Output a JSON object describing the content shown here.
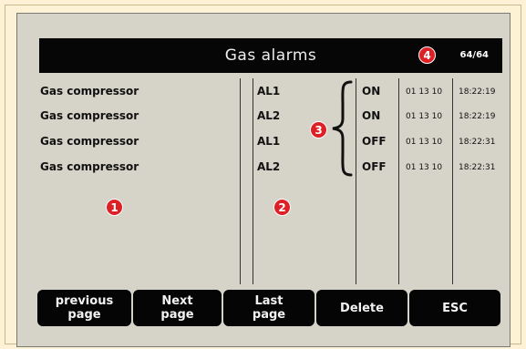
{
  "header": {
    "title": "Gas alarms",
    "counter": "64/64"
  },
  "alarms": [
    {
      "device": "Gas compressor",
      "code": "AL1",
      "state": "ON",
      "date": "01 13 10",
      "time": "18:22:19"
    },
    {
      "device": "Gas compressor",
      "code": "AL2",
      "state": "ON",
      "date": "01 13 10",
      "time": "18:22:19"
    },
    {
      "device": "Gas compressor",
      "code": "AL1",
      "state": "OFF",
      "date": "01 13 10",
      "time": "18:22:31"
    },
    {
      "device": "Gas compressor",
      "code": "AL2",
      "state": "OFF",
      "date": "01 13 10",
      "time": "18:22:31"
    }
  ],
  "callouts": {
    "c1": "1",
    "c2": "2",
    "c3": "3",
    "c4": "4"
  },
  "buttons": {
    "previous": [
      "previous",
      "page"
    ],
    "next": [
      "Next",
      "page"
    ],
    "last": [
      "Last",
      "page"
    ],
    "delete": "Delete",
    "esc": "ESC"
  },
  "colors": {
    "accent": "#dd1f26",
    "bar": "#060606",
    "screen": "#d6d3c9"
  }
}
